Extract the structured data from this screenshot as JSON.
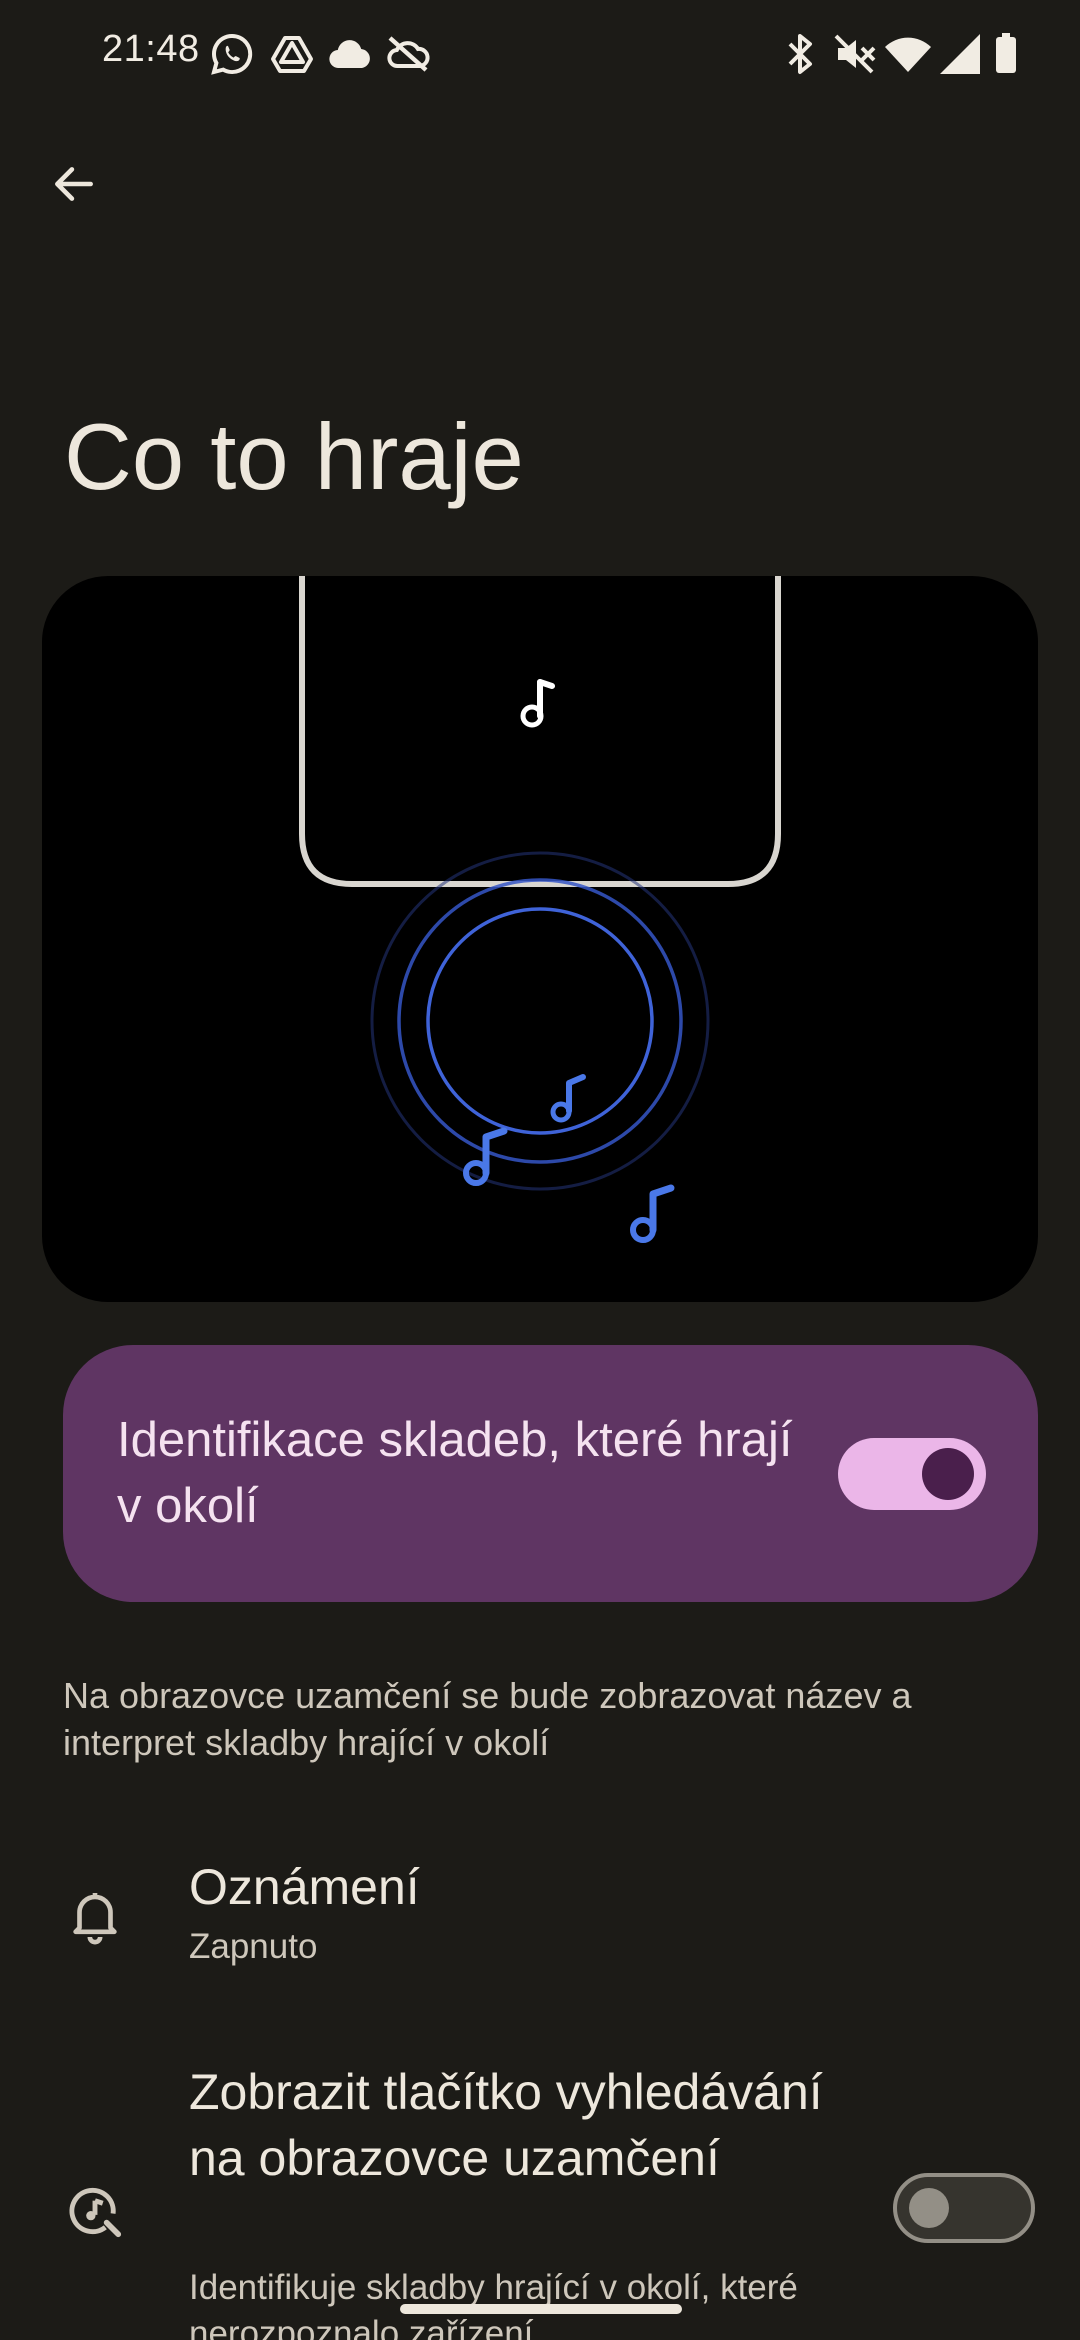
{
  "status_bar": {
    "time": "21:48",
    "left_icons": [
      "whatsapp-icon",
      "drive-icon",
      "cloud-icon",
      "cloud-off-icon"
    ],
    "right_icons": [
      "bluetooth-icon",
      "vibrate-off-icon",
      "wifi-icon",
      "signal-icon",
      "battery-icon"
    ]
  },
  "header": {
    "title": "Co to hraje"
  },
  "main_toggle": {
    "label": "Identifikace skladeb, které hrají v okolí",
    "checked": true,
    "accent_color": "#5f3563"
  },
  "description": "Na obrazovce uzamčení se bude zobrazovat název a interpret skladby hrající v okolí",
  "settings": [
    {
      "icon": "bell-icon",
      "title": "Oznámení",
      "subtitle": "Zapnuto"
    },
    {
      "icon": "music-search-icon",
      "title": "Zobrazit tlačítko vyhledávání na obrazovce uzamčení",
      "subtitle": "Identifikuje skladby hrající v okolí, které nerozpoznalo zařízení",
      "toggle_checked": false
    }
  ]
}
